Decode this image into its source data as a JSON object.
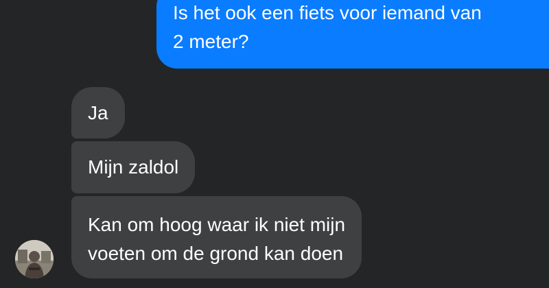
{
  "messages": [
    {
      "direction": "sent",
      "text": "Is het ook een fiets voor iemand van\n2 meter?"
    },
    {
      "direction": "received",
      "text": "Ja"
    },
    {
      "direction": "received",
      "text": "Mijn zaldol"
    },
    {
      "direction": "received",
      "text": "Kan om hoog waar ik niet mijn\nvoeten om de grond kan doen"
    }
  ],
  "colors": {
    "background": "#242526",
    "sent_bubble": "#0a7cff",
    "received_bubble": "#3e4042",
    "text": "#ffffff"
  },
  "avatar": {
    "icon": "contact-avatar-photo"
  }
}
